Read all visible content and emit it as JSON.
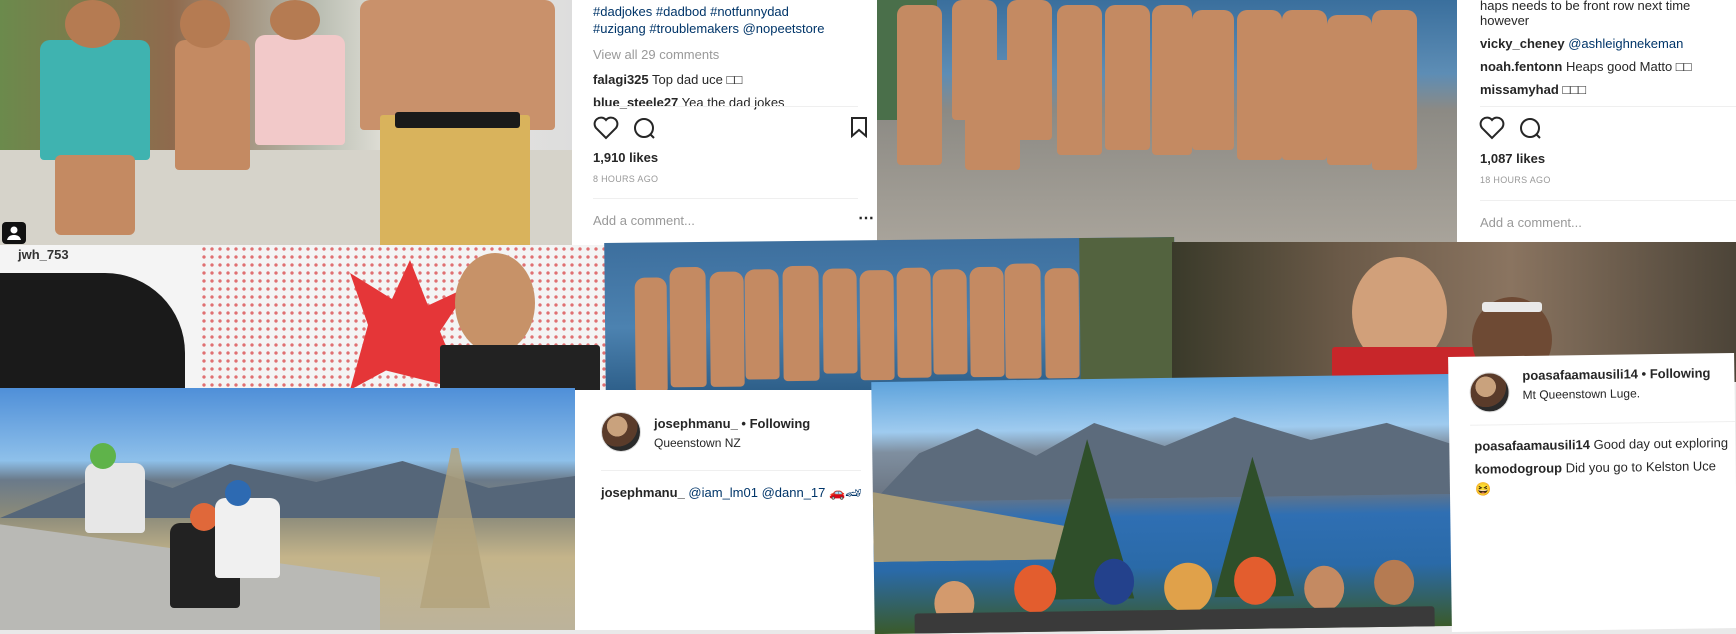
{
  "post_top_left": {
    "hashtags_line1": "#dadjokes #dadbod #notfunnydad",
    "hashtags_line2": "#uzigang #troublemakers @nopeetstore",
    "view_comments": "View all 29 comments",
    "comments": [
      {
        "user": "falagi325",
        "text": "Top dad uce □□"
      },
      {
        "user": "blue_steele27",
        "text": "Yea the dad jokes"
      }
    ],
    "likes": "1,910 likes",
    "time": "8 HOURS AGO",
    "add_comment": "Add a comment..."
  },
  "post_top_right": {
    "caption_line1": "haps needs to be front row next time",
    "caption_line2": "however",
    "comments": [
      {
        "user": "vicky_cheney",
        "text": "@ashleighnekeman"
      },
      {
        "user": "noah.fentonn",
        "text": "Heaps good Matto □□"
      },
      {
        "user": "missamyhad",
        "text": "□□□"
      }
    ],
    "likes": "1,087 likes",
    "time": "18 HOURS AGO",
    "add_comment": "Add a comment..."
  },
  "middle_left": {
    "username": "jwh_753"
  },
  "post_bottom_middle": {
    "username": "josephmanu_",
    "following": "• Following",
    "location": "Queenstown NZ",
    "comment_user": "josephmanu_",
    "comment_text": "@iam_lm01 @dann_17 🚗🏎"
  },
  "post_bottom_right": {
    "username": "poasafaamausili14",
    "following": "• Following",
    "location": "Mt Queenstown Luge.",
    "comments": [
      {
        "user": "poasafaamausili14",
        "text": "Good day out exploring"
      },
      {
        "user": "komodogroup",
        "text": "Did you go to Kelston Uce"
      }
    ],
    "emoji": "😆"
  },
  "icons": [
    "heart-icon",
    "comment-icon",
    "bookmark-icon",
    "more-icon",
    "person-tag-icon"
  ],
  "colors": {
    "ig_text": "#262626",
    "ig_grey": "#999999",
    "ig_link": "#003569",
    "sky": "#5ea3dc",
    "lake": "#2f6fb3"
  }
}
